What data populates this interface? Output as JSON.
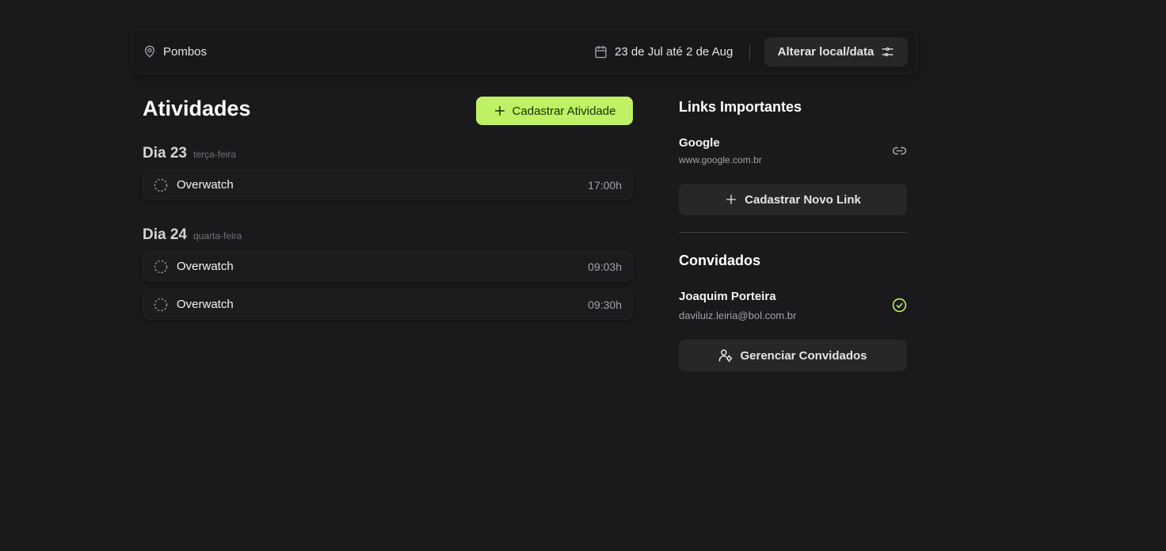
{
  "header": {
    "location_icon": "map-pin-icon",
    "location": "Pombos",
    "calendar_icon": "calendar-icon",
    "date_range": "23 de Jul até 2 de Aug",
    "change_button_label": "Alterar local/data",
    "change_button_icon": "settings-sliders-icon"
  },
  "activities": {
    "title": "Atividades",
    "add_button_label": "Cadastrar Atividade",
    "add_button_icon": "plus-icon",
    "days": [
      {
        "day_label": "Dia 23",
        "weekday": "terça-feira",
        "items": [
          {
            "name": "Overwatch",
            "time": "17:00h"
          }
        ]
      },
      {
        "day_label": "Dia 24",
        "weekday": "quarta-feira",
        "items": [
          {
            "name": "Overwatch",
            "time": "09:03h"
          },
          {
            "name": "Overwatch",
            "time": "09:30h"
          }
        ]
      }
    ]
  },
  "links": {
    "title": "Links Importantes",
    "items": [
      {
        "name": "Google",
        "url": "www.google.com.br",
        "icon": "link-icon"
      }
    ],
    "add_button_label": "Cadastrar Novo Link",
    "add_button_icon": "plus-icon"
  },
  "guests": {
    "title": "Convidados",
    "items": [
      {
        "name": "Joaquim Porteira",
        "email": "daviluiz.leiria@bol.com.br",
        "status_icon": "check-circle-icon"
      }
    ],
    "manage_button_label": "Gerenciar Convidados",
    "manage_button_icon": "user-cog-icon"
  },
  "colors": {
    "background": "#1a1a1c",
    "accent": "#bef264",
    "confirmed": "#bef264"
  }
}
